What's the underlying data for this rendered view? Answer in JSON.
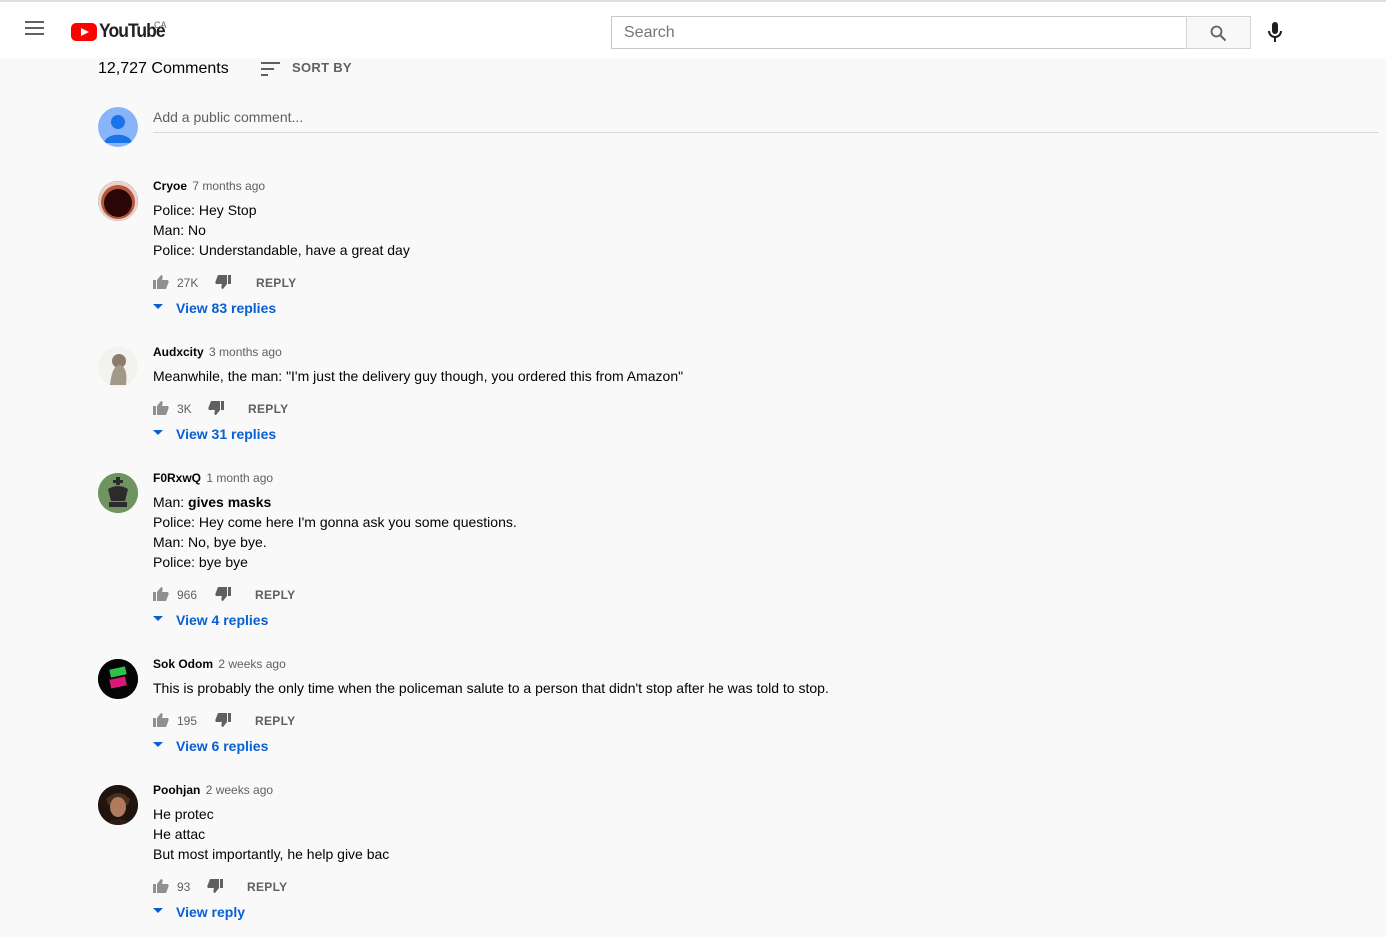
{
  "header": {
    "logo_text": "YouTube",
    "country_code": "CA",
    "search_placeholder": "Search"
  },
  "comments_section": {
    "count_label": "12,727 Comments",
    "sort_label": "SORT BY",
    "add_comment_placeholder": "Add a public comment..."
  },
  "comments": [
    {
      "author": "Cryoe",
      "time": "7 months ago",
      "lines": [
        "Police: Hey Stop",
        "Man: No",
        "Police: Understandable, have a great day"
      ],
      "likes": "27K",
      "reply_label": "REPLY",
      "replies_label": "View 83 replies"
    },
    {
      "author": "Audxcity",
      "time": "3 months ago",
      "lines": [
        "Meanwhile, the man: \"I'm just the delivery guy though, you ordered this from Amazon\""
      ],
      "likes": "3K",
      "reply_label": "REPLY",
      "replies_label": "View 31 replies"
    },
    {
      "author": "F0RxwQ",
      "time": "1 month ago",
      "line1_prefix": "Man: ",
      "line1_bold": "gives masks",
      "lines": [
        "Police: Hey come here I'm gonna ask you some questions.",
        "Man: No, bye bye.",
        "Police: bye bye"
      ],
      "likes": "966",
      "reply_label": "REPLY",
      "replies_label": "View 4 replies"
    },
    {
      "author": "Sok Odom",
      "time": "2 weeks ago",
      "lines": [
        "This is probably the only time when the policeman salute to a person that didn't stop after he was told to stop."
      ],
      "likes": "195",
      "reply_label": "REPLY",
      "replies_label": "View 6 replies"
    },
    {
      "author": "Poohjan",
      "time": "2 weeks ago",
      "lines": [
        "He protec",
        "He attac",
        "But most importantly, he help give bac"
      ],
      "likes": "93",
      "reply_label": "REPLY",
      "replies_label": "View reply"
    }
  ],
  "colors": {
    "brand_red": "#ff0000",
    "link_blue": "#065fd4",
    "secondary_text": "#606060",
    "page_background": "#f9f9f9"
  },
  "icons": [
    "menu-icon",
    "youtube-play-icon",
    "search-icon",
    "microphone-icon",
    "sort-icon",
    "thumbs-up-icon",
    "thumbs-down-icon",
    "chevron-down-icon"
  ]
}
